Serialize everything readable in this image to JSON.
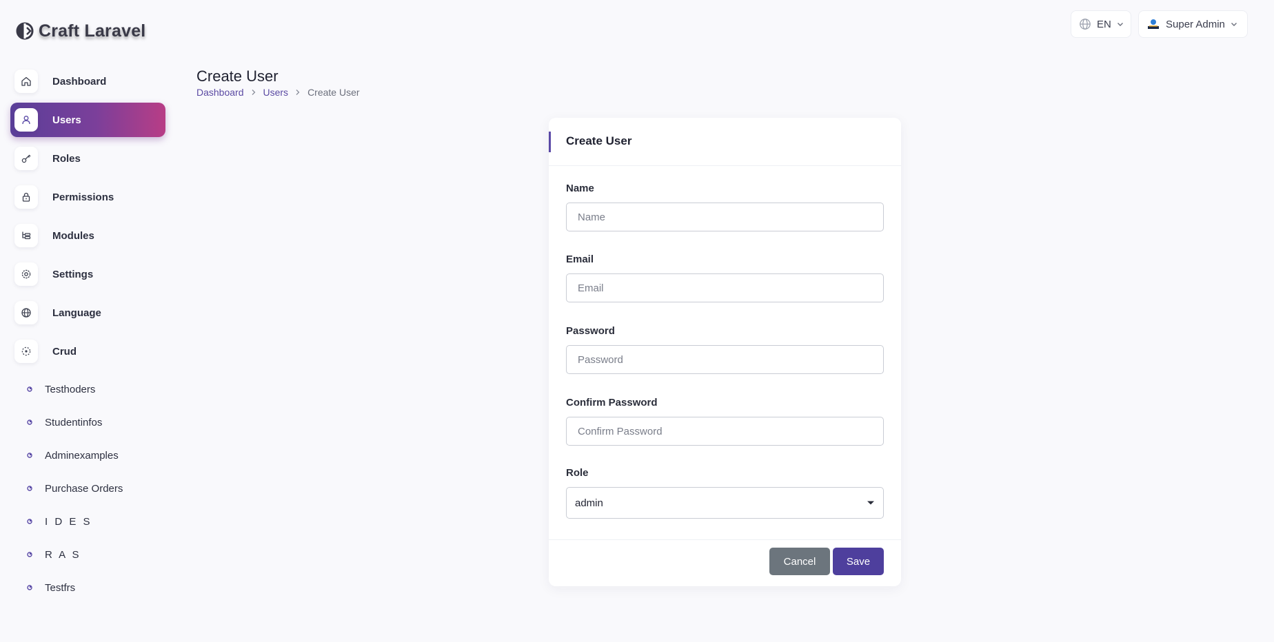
{
  "app": {
    "name": "Craft Laravel"
  },
  "header": {
    "language": {
      "label": "EN",
      "icon": "globe-icon"
    },
    "user": {
      "name": "Super Admin",
      "icon": "avatar"
    }
  },
  "sidebar": {
    "items": [
      {
        "label": "Dashboard",
        "icon": "home-icon",
        "active": false
      },
      {
        "label": "Users",
        "icon": "user-icon",
        "active": true
      },
      {
        "label": "Roles",
        "icon": "key-icon",
        "active": false
      },
      {
        "label": "Permissions",
        "icon": "lock-icon",
        "active": false
      },
      {
        "label": "Modules",
        "icon": "modules-icon",
        "active": false
      },
      {
        "label": "Settings",
        "icon": "gear-icon",
        "active": false
      },
      {
        "label": "Language",
        "icon": "globe-icon",
        "active": false
      },
      {
        "label": "Crud",
        "icon": "crud-icon",
        "active": false
      }
    ],
    "crud_items": [
      {
        "label": "Testhoders"
      },
      {
        "label": "Studentinfos"
      },
      {
        "label": "Adminexamples"
      },
      {
        "label": "Purchase Orders"
      },
      {
        "label": "I D E S"
      },
      {
        "label": "R A S"
      },
      {
        "label": "Testfrs"
      }
    ]
  },
  "page": {
    "title": "Create User",
    "breadcrumb": [
      "Dashboard",
      "Users",
      "Create User"
    ]
  },
  "form": {
    "title": "Create User",
    "fields": {
      "name": {
        "label": "Name",
        "placeholder": "Name",
        "value": ""
      },
      "email": {
        "label": "Email",
        "placeholder": "Email",
        "value": ""
      },
      "password": {
        "label": "Password",
        "placeholder": "Password",
        "value": ""
      },
      "confirm_password": {
        "label": "Confirm Password",
        "placeholder": "Confirm Password",
        "value": ""
      },
      "role": {
        "label": "Role",
        "value": "admin"
      }
    },
    "cancel_label": "Cancel",
    "save_label": "Save"
  },
  "colors": {
    "accent": "#4e3f9d",
    "active_gradient_start": "#5a3f99",
    "active_gradient_end": "#b83d86",
    "cancel": "#6c757d",
    "background": "#f9f9fc"
  }
}
